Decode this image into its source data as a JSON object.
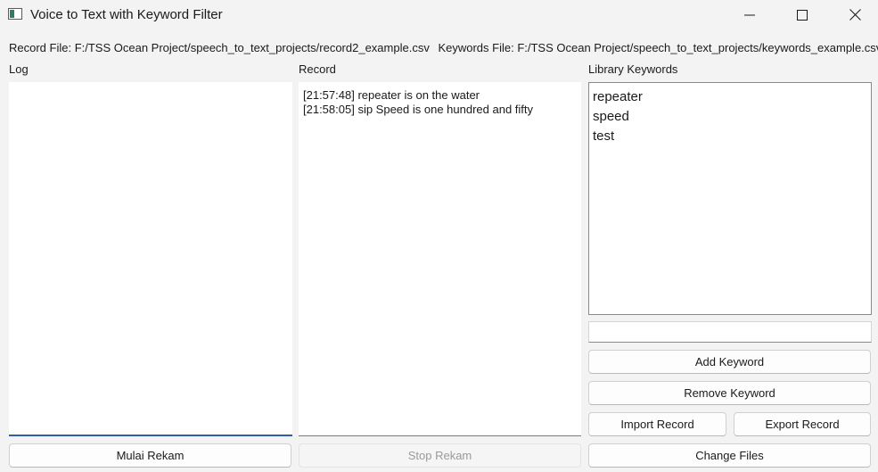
{
  "window": {
    "title": "Voice to Text with Keyword Filter"
  },
  "files": {
    "record_file": "Record File: F:/TSS Ocean Project/speech_to_text_projects/record2_example.csv",
    "keywords_file": "Keywords File: F:/TSS Ocean Project/speech_to_text_projects/keywords_example.csv"
  },
  "labels": {
    "log": "Log",
    "record": "Record",
    "library": "Library Keywords"
  },
  "record": {
    "lines": [
      "[21:57:48] repeater is on the water",
      "[21:58:05] sip Speed is one hundred and fifty"
    ]
  },
  "library": {
    "keywords": [
      "repeater",
      "speed",
      "test"
    ]
  },
  "keyword_input": {
    "value": ""
  },
  "buttons": {
    "add_keyword": "Add Keyword",
    "remove_keyword": "Remove Keyword",
    "import_record": "Import Record",
    "export_record": "Export Record",
    "change_files": "Change Files",
    "start": "Mulai Rekam",
    "stop": "Stop Rekam"
  },
  "icons": {
    "app": "app-window-icon",
    "minimize": "minimize-icon",
    "maximize": "maximize-icon",
    "close": "close-icon"
  }
}
